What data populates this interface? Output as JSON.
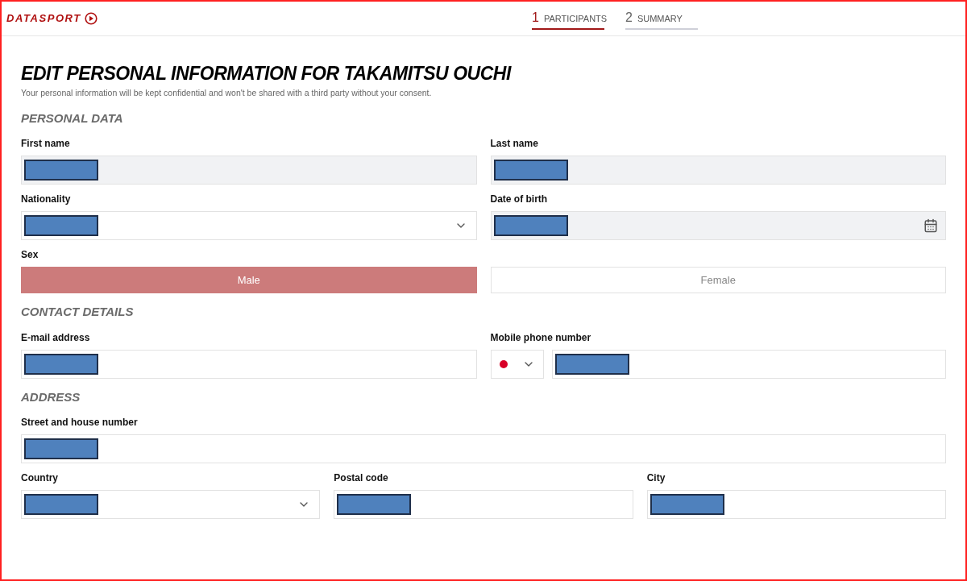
{
  "header": {
    "logo": "DATASPORT",
    "steps": [
      {
        "number": "1",
        "label": "PARTICIPANTS",
        "selected": true
      },
      {
        "number": "2",
        "label": "SUMMARY",
        "selected": false
      }
    ]
  },
  "title": "EDIT PERSONAL INFORMATION FOR TAKAMITSU OUCHI",
  "subtitle": "Your personal information will be kept confidential and won't be shared with a third party without your consent.",
  "sections": [
    {
      "heading": "PERSONAL DATA",
      "rows": [
        [
          {
            "kind": "text",
            "label": "First name",
            "disabled": true,
            "redacted": true
          },
          {
            "kind": "text",
            "label": "Last name",
            "disabled": true,
            "redacted": true
          }
        ],
        [
          {
            "kind": "select",
            "label": "Nationality",
            "disabled": false,
            "redacted": true
          },
          {
            "kind": "date",
            "label": "Date of birth",
            "disabled": true,
            "redacted": true
          }
        ],
        [
          {
            "kind": "choice",
            "label": "Sex",
            "options": [
              {
                "label": "Male",
                "selected": true
              },
              {
                "label": "Female",
                "selected": false
              }
            ]
          }
        ]
      ]
    },
    {
      "heading": "CONTACT DETAILS",
      "rows": [
        [
          {
            "kind": "text",
            "label": "E-mail address",
            "disabled": false,
            "redacted": true
          },
          {
            "kind": "phone",
            "label": "Mobile phone number",
            "disabled": false,
            "redacted": true
          }
        ]
      ]
    },
    {
      "heading": "ADDRESS",
      "rows": [
        [
          {
            "kind": "text",
            "label": "Street and house number",
            "disabled": false,
            "redacted": true
          }
        ],
        [
          {
            "kind": "select",
            "label": "Country",
            "disabled": false,
            "redacted": true
          },
          {
            "kind": "text",
            "label": "Postal code",
            "disabled": false,
            "redacted": true
          },
          {
            "kind": "text",
            "label": "City",
            "disabled": false,
            "redacted": true
          }
        ]
      ]
    }
  ]
}
